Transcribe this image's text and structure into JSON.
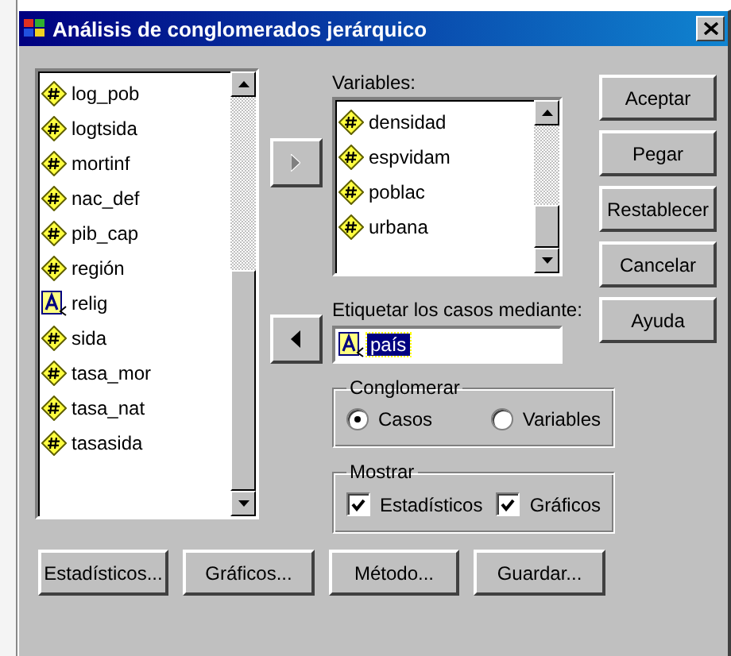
{
  "window": {
    "title": "Análisis de conglomerados jerárquico"
  },
  "source_list": {
    "items": [
      {
        "name": "log_pob",
        "kind": "numeric"
      },
      {
        "name": "logtsida",
        "kind": "numeric"
      },
      {
        "name": "mortinf",
        "kind": "numeric"
      },
      {
        "name": "nac_def",
        "kind": "numeric"
      },
      {
        "name": "pib_cap",
        "kind": "numeric"
      },
      {
        "name": "región",
        "kind": "numeric"
      },
      {
        "name": "relig",
        "kind": "string"
      },
      {
        "name": "sida",
        "kind": "numeric"
      },
      {
        "name": "tasa_mor",
        "kind": "numeric"
      },
      {
        "name": "tasa_nat",
        "kind": "numeric"
      },
      {
        "name": "tasasida",
        "kind": "numeric"
      }
    ]
  },
  "move_buttons": [
    {
      "kind": "right",
      "disabled": true
    },
    {
      "kind": "left",
      "disabled": false
    }
  ],
  "variables": {
    "label": "Variables:",
    "items": [
      {
        "name": "densidad",
        "kind": "numeric"
      },
      {
        "name": "espvidam",
        "kind": "numeric"
      },
      {
        "name": "poblac",
        "kind": "numeric"
      },
      {
        "name": "urbana",
        "kind": "numeric"
      }
    ]
  },
  "label_cases": {
    "label": "Etiquetar los casos mediante:",
    "value": "país",
    "kind": "string",
    "selected": true
  },
  "cluster": {
    "title": "Conglomerar",
    "options": [
      {
        "label": "Casos",
        "selected": true
      },
      {
        "label": "Variables",
        "selected": false
      }
    ]
  },
  "display": {
    "title": "Mostrar",
    "options": [
      {
        "label": "Estadísticos",
        "checked": true
      },
      {
        "label": "Gráficos",
        "checked": true
      }
    ]
  },
  "side_buttons": [
    {
      "label": "Aceptar"
    },
    {
      "label": "Pegar"
    },
    {
      "label": "Restablecer"
    },
    {
      "label": "Cancelar"
    },
    {
      "label": "Ayuda"
    }
  ],
  "bottom_buttons": [
    {
      "label": "Estadísticos..."
    },
    {
      "label": "Gráficos..."
    },
    {
      "label": "Método..."
    },
    {
      "label": "Guardar..."
    }
  ]
}
